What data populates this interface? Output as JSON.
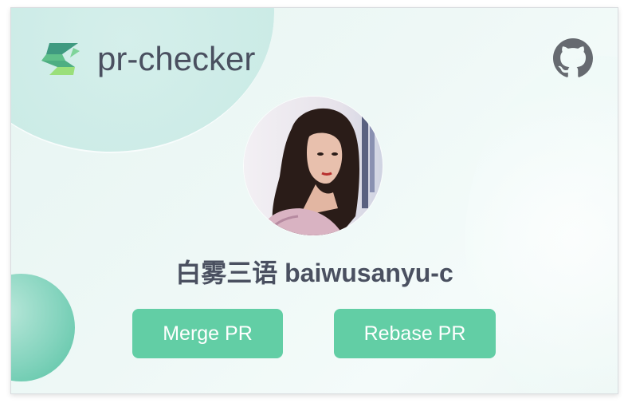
{
  "app": {
    "title": "pr-checker"
  },
  "user": {
    "display_name": "白雾三语  baiwusanyu-c"
  },
  "actions": {
    "merge_label": "Merge PR",
    "rebase_label": "Rebase PR"
  },
  "icons": {
    "logo": "app-logo-icon",
    "repo_link": "github-icon"
  },
  "colors": {
    "primary_button": "#62cea5",
    "title_text": "#4a5060",
    "logo_dark": "#3f9a80",
    "logo_light": "#9adf7a"
  }
}
